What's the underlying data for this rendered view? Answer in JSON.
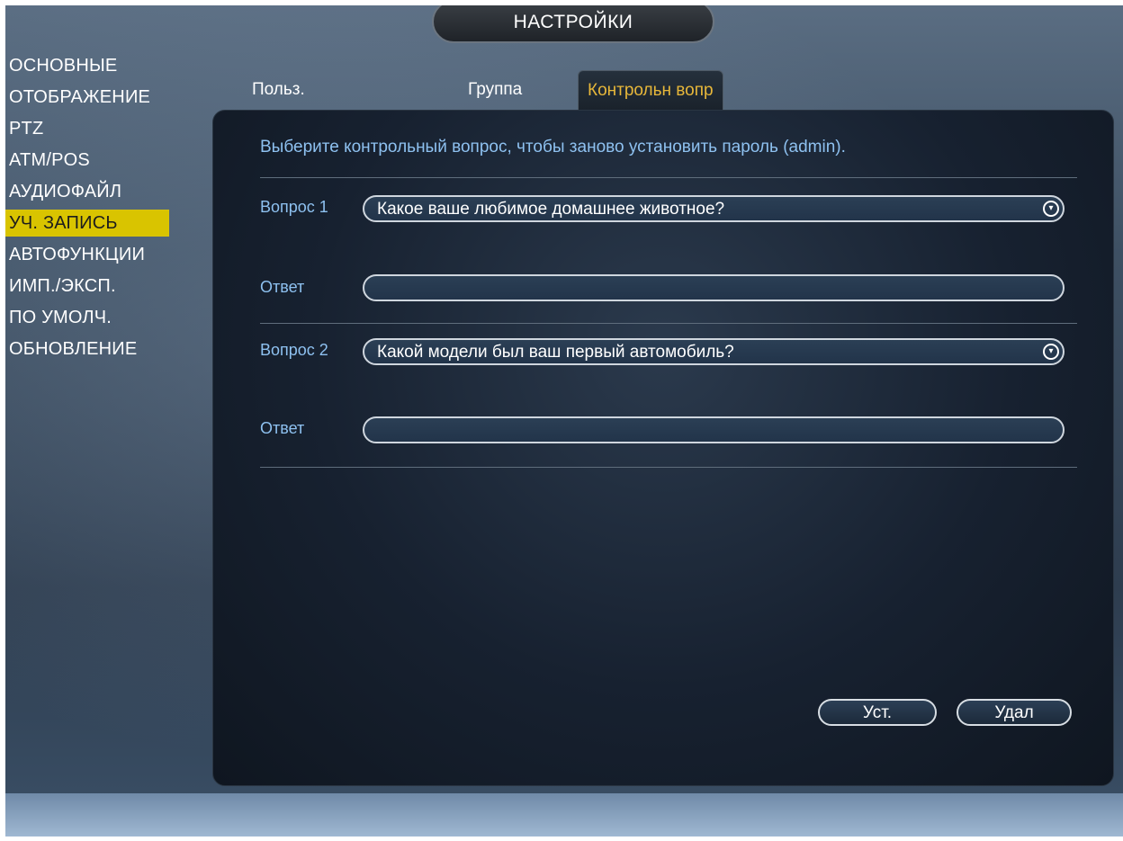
{
  "window": {
    "title": "НАСТРОЙКИ"
  },
  "sidebar": {
    "items": [
      {
        "label": "ОСНОВНЫЕ"
      },
      {
        "label": "ОТОБРАЖЕНИЕ"
      },
      {
        "label": "PTZ"
      },
      {
        "label": "ATM/POS"
      },
      {
        "label": "АУДИОФАЙЛ"
      },
      {
        "label": "УЧ. ЗАПИСЬ",
        "active": true
      },
      {
        "label": "АВТОФУНКЦИИ"
      },
      {
        "label": "ИМП./ЭКСП."
      },
      {
        "label": "ПО УМОЛЧ."
      },
      {
        "label": "ОБНОВЛЕНИЕ"
      }
    ]
  },
  "tabs": [
    {
      "label": "Польз."
    },
    {
      "label": "Группа"
    },
    {
      "label": "Контрольн вопр",
      "active": true
    }
  ],
  "main": {
    "hint": "Выберите контрольный вопрос, чтобы заново установить пароль (admin).",
    "question1": {
      "label": "Вопрос 1",
      "value": "Какое ваше любимое домашнее животное?"
    },
    "answer1": {
      "label": "Ответ",
      "value": ""
    },
    "question2": {
      "label": "Вопрос 2",
      "value": "Какой модели был ваш первый автомобиль?"
    },
    "answer2": {
      "label": "Ответ",
      "value": ""
    },
    "buttons": {
      "set_label": "Уст.",
      "delete_label": "Удал"
    }
  },
  "colors": {
    "accent_tab": "#e7b73a",
    "active_menu": "#d9c400",
    "hint_text": "#8ec1f0"
  }
}
